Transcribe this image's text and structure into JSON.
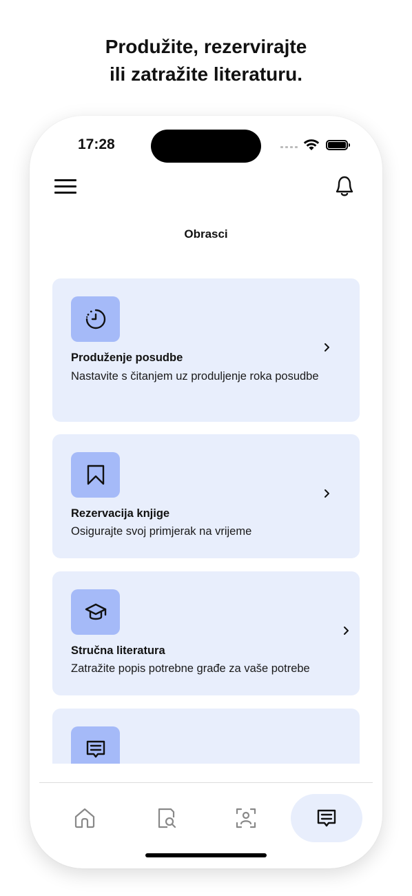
{
  "headline": {
    "line1": "Produžite, rezervirajte",
    "line2": "ili zatražite literaturu."
  },
  "status_bar": {
    "time": "17:28"
  },
  "header": {
    "title": "Obrasci"
  },
  "cards": [
    {
      "title": "Produženje posudbe",
      "description": "Nastavite s čitanjem uz produljenje roka posudbe",
      "icon": "timer-icon"
    },
    {
      "title": "Rezervacija knjige",
      "description": "Osigurajte svoj primjerak na vrijeme",
      "icon": "bookmark-icon"
    },
    {
      "title": "Stručna literatura",
      "description": "Zatražite popis potrebne građe za vaše potrebe",
      "icon": "graduation-cap-icon"
    },
    {
      "title": "",
      "description": "",
      "icon": "message-icon"
    }
  ],
  "tabs": [
    {
      "icon": "home-icon",
      "active": false
    },
    {
      "icon": "document-search-icon",
      "active": false
    },
    {
      "icon": "scan-user-icon",
      "active": false
    },
    {
      "icon": "message-icon",
      "active": true
    }
  ],
  "colors": {
    "card_bg": "#e8eefc",
    "icon_box_bg": "#a5baf8",
    "active_tab_bg": "#e8eefc",
    "text": "#111111"
  }
}
